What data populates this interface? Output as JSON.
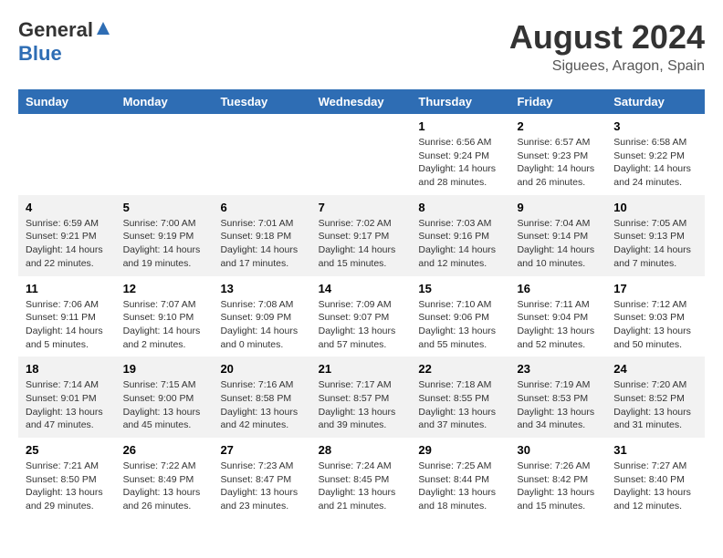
{
  "header": {
    "logo_general": "General",
    "logo_blue": "Blue",
    "title": "August 2024",
    "subtitle": "Siguees, Aragon, Spain"
  },
  "days_of_week": [
    "Sunday",
    "Monday",
    "Tuesday",
    "Wednesday",
    "Thursday",
    "Friday",
    "Saturday"
  ],
  "weeks": [
    [
      {
        "day": "",
        "info": ""
      },
      {
        "day": "",
        "info": ""
      },
      {
        "day": "",
        "info": ""
      },
      {
        "day": "",
        "info": ""
      },
      {
        "day": "1",
        "info": "Sunrise: 6:56 AM\nSunset: 9:24 PM\nDaylight: 14 hours\nand 28 minutes."
      },
      {
        "day": "2",
        "info": "Sunrise: 6:57 AM\nSunset: 9:23 PM\nDaylight: 14 hours\nand 26 minutes."
      },
      {
        "day": "3",
        "info": "Sunrise: 6:58 AM\nSunset: 9:22 PM\nDaylight: 14 hours\nand 24 minutes."
      }
    ],
    [
      {
        "day": "4",
        "info": "Sunrise: 6:59 AM\nSunset: 9:21 PM\nDaylight: 14 hours\nand 22 minutes."
      },
      {
        "day": "5",
        "info": "Sunrise: 7:00 AM\nSunset: 9:19 PM\nDaylight: 14 hours\nand 19 minutes."
      },
      {
        "day": "6",
        "info": "Sunrise: 7:01 AM\nSunset: 9:18 PM\nDaylight: 14 hours\nand 17 minutes."
      },
      {
        "day": "7",
        "info": "Sunrise: 7:02 AM\nSunset: 9:17 PM\nDaylight: 14 hours\nand 15 minutes."
      },
      {
        "day": "8",
        "info": "Sunrise: 7:03 AM\nSunset: 9:16 PM\nDaylight: 14 hours\nand 12 minutes."
      },
      {
        "day": "9",
        "info": "Sunrise: 7:04 AM\nSunset: 9:14 PM\nDaylight: 14 hours\nand 10 minutes."
      },
      {
        "day": "10",
        "info": "Sunrise: 7:05 AM\nSunset: 9:13 PM\nDaylight: 14 hours\nand 7 minutes."
      }
    ],
    [
      {
        "day": "11",
        "info": "Sunrise: 7:06 AM\nSunset: 9:11 PM\nDaylight: 14 hours\nand 5 minutes."
      },
      {
        "day": "12",
        "info": "Sunrise: 7:07 AM\nSunset: 9:10 PM\nDaylight: 14 hours\nand 2 minutes."
      },
      {
        "day": "13",
        "info": "Sunrise: 7:08 AM\nSunset: 9:09 PM\nDaylight: 14 hours\nand 0 minutes."
      },
      {
        "day": "14",
        "info": "Sunrise: 7:09 AM\nSunset: 9:07 PM\nDaylight: 13 hours\nand 57 minutes."
      },
      {
        "day": "15",
        "info": "Sunrise: 7:10 AM\nSunset: 9:06 PM\nDaylight: 13 hours\nand 55 minutes."
      },
      {
        "day": "16",
        "info": "Sunrise: 7:11 AM\nSunset: 9:04 PM\nDaylight: 13 hours\nand 52 minutes."
      },
      {
        "day": "17",
        "info": "Sunrise: 7:12 AM\nSunset: 9:03 PM\nDaylight: 13 hours\nand 50 minutes."
      }
    ],
    [
      {
        "day": "18",
        "info": "Sunrise: 7:14 AM\nSunset: 9:01 PM\nDaylight: 13 hours\nand 47 minutes."
      },
      {
        "day": "19",
        "info": "Sunrise: 7:15 AM\nSunset: 9:00 PM\nDaylight: 13 hours\nand 45 minutes."
      },
      {
        "day": "20",
        "info": "Sunrise: 7:16 AM\nSunset: 8:58 PM\nDaylight: 13 hours\nand 42 minutes."
      },
      {
        "day": "21",
        "info": "Sunrise: 7:17 AM\nSunset: 8:57 PM\nDaylight: 13 hours\nand 39 minutes."
      },
      {
        "day": "22",
        "info": "Sunrise: 7:18 AM\nSunset: 8:55 PM\nDaylight: 13 hours\nand 37 minutes."
      },
      {
        "day": "23",
        "info": "Sunrise: 7:19 AM\nSunset: 8:53 PM\nDaylight: 13 hours\nand 34 minutes."
      },
      {
        "day": "24",
        "info": "Sunrise: 7:20 AM\nSunset: 8:52 PM\nDaylight: 13 hours\nand 31 minutes."
      }
    ],
    [
      {
        "day": "25",
        "info": "Sunrise: 7:21 AM\nSunset: 8:50 PM\nDaylight: 13 hours\nand 29 minutes."
      },
      {
        "day": "26",
        "info": "Sunrise: 7:22 AM\nSunset: 8:49 PM\nDaylight: 13 hours\nand 26 minutes."
      },
      {
        "day": "27",
        "info": "Sunrise: 7:23 AM\nSunset: 8:47 PM\nDaylight: 13 hours\nand 23 minutes."
      },
      {
        "day": "28",
        "info": "Sunrise: 7:24 AM\nSunset: 8:45 PM\nDaylight: 13 hours\nand 21 minutes."
      },
      {
        "day": "29",
        "info": "Sunrise: 7:25 AM\nSunset: 8:44 PM\nDaylight: 13 hours\nand 18 minutes."
      },
      {
        "day": "30",
        "info": "Sunrise: 7:26 AM\nSunset: 8:42 PM\nDaylight: 13 hours\nand 15 minutes."
      },
      {
        "day": "31",
        "info": "Sunrise: 7:27 AM\nSunset: 8:40 PM\nDaylight: 13 hours\nand 12 minutes."
      }
    ]
  ]
}
